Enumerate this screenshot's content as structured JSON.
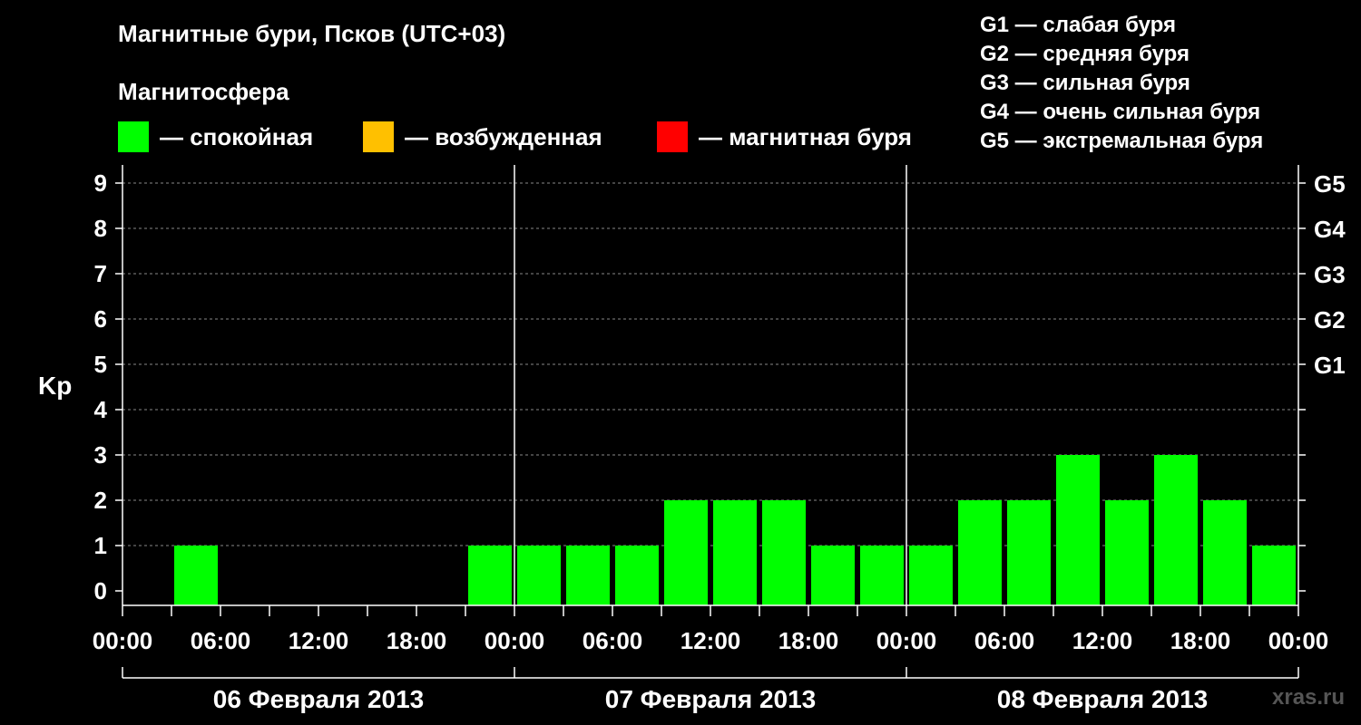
{
  "chart_data": {
    "type": "bar",
    "title": "Магнитные бури, Псков (UTC+03)",
    "subtitle": "Магнитосфера",
    "ylabel": "Kp",
    "ylim": [
      0,
      9
    ],
    "yticks": [
      "0",
      "1",
      "2",
      "3",
      "4",
      "5",
      "6",
      "7",
      "8",
      "9"
    ],
    "right_ticks": [
      {
        "level": 5,
        "label": "G1"
      },
      {
        "level": 6,
        "label": "G2"
      },
      {
        "level": 7,
        "label": "G3"
      },
      {
        "level": 8,
        "label": "G4"
      },
      {
        "level": 9,
        "label": "G5"
      }
    ],
    "x_tick_labels": [
      "00:00",
      "06:00",
      "12:00",
      "18:00",
      "00:00",
      "06:00",
      "12:00",
      "18:00",
      "00:00",
      "06:00",
      "12:00",
      "18:00",
      "00:00"
    ],
    "days": [
      "06 Февраля 2013",
      "07 Февраля 2013",
      "08 Февраля 2013"
    ],
    "interval_hours": 3,
    "values": [
      0,
      1,
      0,
      0,
      0,
      0,
      0,
      1,
      1,
      1,
      1,
      2,
      2,
      2,
      1,
      1,
      1,
      2,
      2,
      3,
      2,
      3,
      2,
      1
    ],
    "grid": true,
    "legend": [
      {
        "label": "— спокойная",
        "color": "#00ff00"
      },
      {
        "label": "— возбужденная",
        "color": "#ffc000"
      },
      {
        "label": "— магнитная буря",
        "color": "#ff0000"
      }
    ],
    "g_scale": [
      "G1 — слабая буря",
      "G2 — средняя буря",
      "G3 — сильная буря",
      "G4 — очень сильная буря",
      "G5 — экстремальная буря"
    ]
  },
  "watermark": "xras.ru"
}
